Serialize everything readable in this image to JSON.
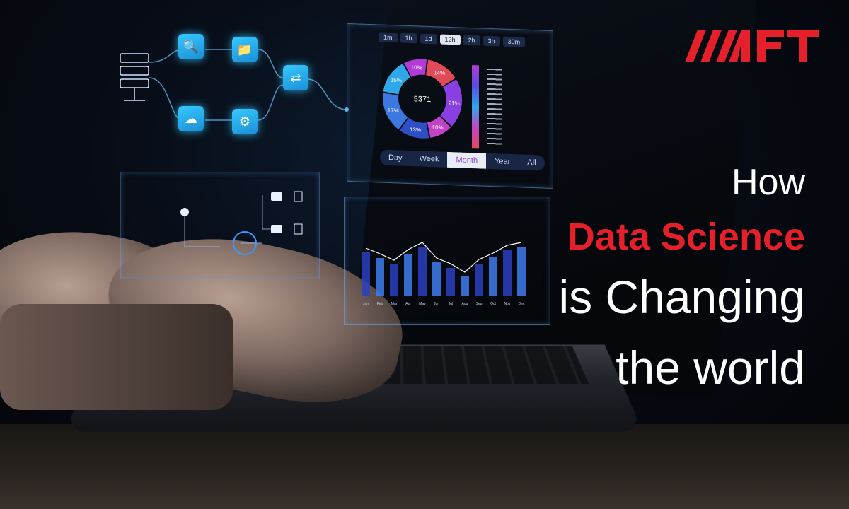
{
  "brand": {
    "logo_text": "AAFT",
    "accent": "#e5202a"
  },
  "headline": {
    "line1": "How",
    "line2": "Data Science",
    "line3": "is Changing",
    "line4": "the world"
  },
  "dashboard": {
    "top_tabs": [
      "1m",
      "1h",
      "1d",
      "12h",
      "2h",
      "3h",
      "30m"
    ],
    "donut_center": "5371",
    "donut_slices": [
      {
        "label": "10%",
        "value": 10,
        "color": "#b23bd6"
      },
      {
        "label": "14%",
        "value": 14,
        "color": "#e24a5a"
      },
      {
        "label": "21%",
        "value": 21,
        "color": "#8a3fe0"
      },
      {
        "label": "10%",
        "value": 10,
        "color": "#c243c8"
      },
      {
        "label": "13%",
        "value": 13,
        "color": "#2f4fc7"
      },
      {
        "label": "17%",
        "value": 17,
        "color": "#3c78e0"
      },
      {
        "label": "15%",
        "value": 15,
        "color": "#2ea8e8"
      }
    ],
    "range_tabs": [
      "Day",
      "Week",
      "Month",
      "Year",
      "All"
    ],
    "range_selected": "Month"
  },
  "bar_chart": {
    "months": [
      "Jan",
      "Feb",
      "Mar",
      "Apr",
      "May",
      "Jun",
      "Jul",
      "Aug",
      "Sep",
      "Oct",
      "Nov",
      "Dec"
    ]
  }
}
